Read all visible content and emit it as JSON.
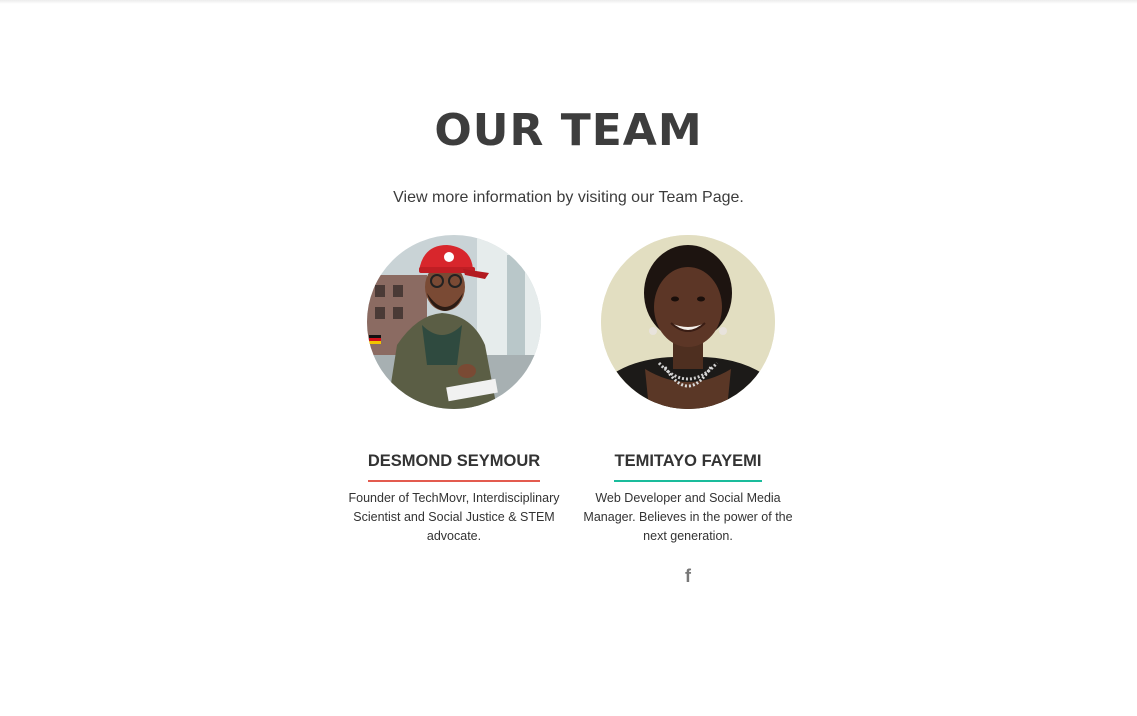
{
  "section": {
    "title": "OUR TEAM",
    "subtitle": "View more information by visiting our Team Page."
  },
  "members": [
    {
      "name": "DESMOND SEYMOUR",
      "bio": "Founder of TechMovr, Interdisciplinary Scientist and Social Justice & STEM advocate.",
      "accent": "#e35b4f"
    },
    {
      "name": "TEMITAYO FAYEMI",
      "bio": "Web Developer and Social Media Manager. Believes in the power of the next generation.",
      "accent": "#1abc9c",
      "social_icon": "facebook-icon",
      "social_glyph": "f"
    }
  ]
}
